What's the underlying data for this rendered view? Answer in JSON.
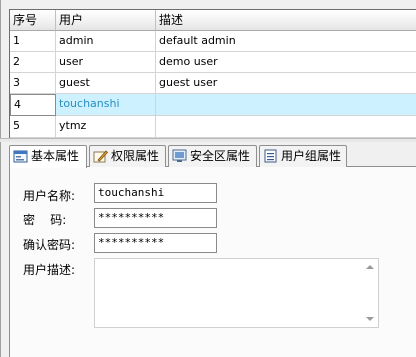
{
  "grid": {
    "columns": [
      "序号",
      "用户",
      "描述"
    ],
    "rows": [
      {
        "no": "1",
        "user": "admin",
        "desc": "default admin"
      },
      {
        "no": "2",
        "user": "user",
        "desc": "demo user"
      },
      {
        "no": "3",
        "user": "guest",
        "desc": "guest user"
      },
      {
        "no": "4",
        "user": "touchanshi",
        "desc": ""
      },
      {
        "no": "5",
        "user": "ytmz",
        "desc": ""
      }
    ],
    "selected_row": "4",
    "selection_color": "#cdf1ff"
  },
  "tabs": [
    {
      "label": "基本属性",
      "icon": "user-properties-icon"
    },
    {
      "label": "权限属性",
      "icon": "permission-edit-icon"
    },
    {
      "label": "安全区属性",
      "icon": "security-zone-icon"
    },
    {
      "label": "用户组属性",
      "icon": "user-group-list-icon"
    }
  ],
  "active_tab": "基本属性",
  "form": {
    "username_label": "用户名称:",
    "username_value": "touchanshi",
    "password_label": "密    码:",
    "password_value": "**********",
    "confirm_label": "确认密码:",
    "confirm_value": "**********",
    "description_label": "用户描述:",
    "description_value": ""
  }
}
